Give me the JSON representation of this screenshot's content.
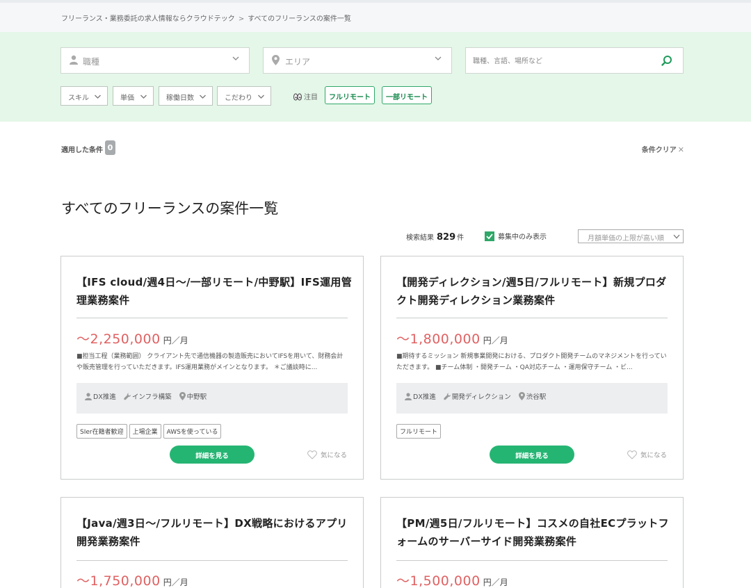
{
  "breadcrumb": {
    "home": "フリーランス・業務委託の求人情報ならクラウドテック",
    "separator": ">",
    "current": "すべてのフリーランスの案件一覧"
  },
  "search": {
    "job_type_label": "職種",
    "area_label": "エリア",
    "keyword_placeholder": "職種、言語、場所など",
    "filters": [
      "スキル",
      "単価",
      "稼働日数",
      "こだわり"
    ],
    "attention_label": "注目",
    "quick_tags": [
      "フルリモート",
      "一部リモート"
    ]
  },
  "conditions": {
    "applied_label": "適用した条件",
    "applied_count": "0",
    "clear_label": "条件クリア"
  },
  "page_title": "すべてのフリーランスの案件一覧",
  "results": {
    "label": "検索結果",
    "count": "829",
    "unit": "件",
    "recruiting_only_label": "募集中のみ表示",
    "recruiting_only_checked": true,
    "sort_selected": "月額単価の上限が高い順"
  },
  "colors": {
    "accent_green": "#25b573",
    "price_red": "#e06162",
    "panel_bg": "#e4f7e8"
  },
  "jobs": [
    {
      "title": "【IFS cloud/週4日〜/一部リモート/中野駅】IFS運用管理業務案件",
      "price": "〜2,250,000",
      "unit": "円／月",
      "description": "■担当工程（業務範囲） クライアント先で通信機器の製造販売においてIFSを用いて、財務会計や販売管理を行っていただきます。IFS運用業務がメインとなります。 ＊ご議談時に...",
      "category": "DX推進",
      "role": "インフラ構築",
      "location": "中野駅",
      "tags": [
        "SIer在籍者歓迎",
        "上場企業",
        "AWSを使っている"
      ],
      "detail_label": "詳細を見る",
      "fav_label": "気になる"
    },
    {
      "title": "【開発ディレクション/週5日/フルリモート】新規プロダクト開発ディレクション業務案件",
      "price": "〜1,800,000",
      "unit": "円／月",
      "description": "■期待するミッション 新規事業開発における、プロダクト開発チームのマネジメントを行っていただきます。 ■チーム体制 ・開発チーム ・QA対応チーム ・運用保守チーム ・ビ...",
      "category": "DX推進",
      "role": "開発ディレクション",
      "location": "渋谷駅",
      "tags": [
        "フルリモート"
      ],
      "detail_label": "詳細を見る",
      "fav_label": "気になる"
    },
    {
      "title": "【Java/週3日〜/フルリモート】DX戦略におけるアプリ開発業務案件",
      "price": "〜1,750,000",
      "unit": "円／月"
    },
    {
      "title": "【PM/週5日/フルリモート】コスメの自社ECプラットフォームのサーバーサイド開発業務案件",
      "price": "〜1,500,000",
      "unit": "円／月"
    }
  ]
}
